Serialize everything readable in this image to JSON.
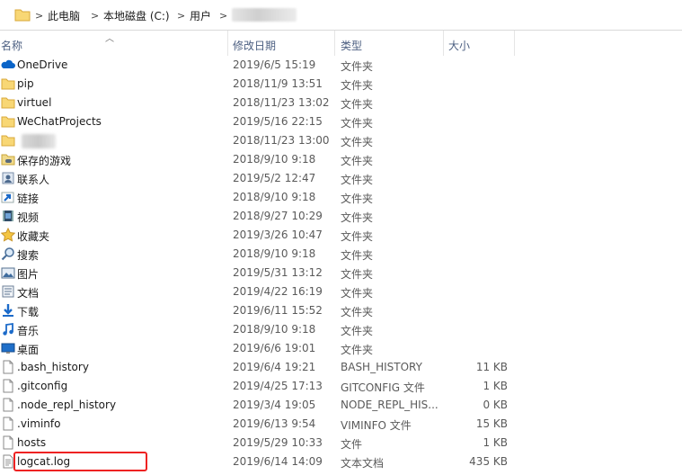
{
  "address_bar": {
    "crumbs": [
      "此电脑",
      "本地磁盘 (C:)",
      "用户"
    ],
    "separator": ">"
  },
  "columns": {
    "name": "名称",
    "date": "修改日期",
    "type": "类型",
    "size": "大小"
  },
  "icon_names": {
    "folder": "folder-icon",
    "onedrive": "onedrive-cloud-icon",
    "file": "document-file-icon"
  },
  "colors": {
    "folder_yellow": "#f8d775",
    "header_text": "#4d6082",
    "highlight_border": "#e22222",
    "onedrive_blue": "#0a64c8"
  },
  "files": [
    {
      "name": "OneDrive",
      "date": "2019/6/5 15:19",
      "type": "文件夹",
      "size": "",
      "icon": "onedrive"
    },
    {
      "name": "pip",
      "date": "2018/11/9 13:51",
      "type": "文件夹",
      "size": "",
      "icon": "folder"
    },
    {
      "name": "virtuel",
      "date": "2018/11/23 13:02",
      "type": "文件夹",
      "size": "",
      "icon": "folder"
    },
    {
      "name": "WeChatProjects",
      "date": "2019/5/16 22:15",
      "type": "文件夹",
      "size": "",
      "icon": "folder"
    },
    {
      "name": "",
      "date": "2018/11/23 13:00",
      "type": "文件夹",
      "size": "",
      "icon": "folder"
    },
    {
      "name": "保存的游戏",
      "date": "2018/9/10 9:18",
      "type": "文件夹",
      "size": "",
      "icon": "games"
    },
    {
      "name": "联系人",
      "date": "2019/5/2 12:47",
      "type": "文件夹",
      "size": "",
      "icon": "contacts"
    },
    {
      "name": "链接",
      "date": "2018/9/10 9:18",
      "type": "文件夹",
      "size": "",
      "icon": "links"
    },
    {
      "name": "视频",
      "date": "2018/9/27 10:29",
      "type": "文件夹",
      "size": "",
      "icon": "videos"
    },
    {
      "name": "收藏夹",
      "date": "2019/3/26 10:47",
      "type": "文件夹",
      "size": "",
      "icon": "favorites"
    },
    {
      "name": "搜索",
      "date": "2018/9/10 9:18",
      "type": "文件夹",
      "size": "",
      "icon": "search"
    },
    {
      "name": "图片",
      "date": "2019/5/31 13:12",
      "type": "文件夹",
      "size": "",
      "icon": "pictures"
    },
    {
      "name": "文档",
      "date": "2019/4/22 16:19",
      "type": "文件夹",
      "size": "",
      "icon": "documents"
    },
    {
      "name": "下载",
      "date": "2019/6/11 15:52",
      "type": "文件夹",
      "size": "",
      "icon": "downloads"
    },
    {
      "name": "音乐",
      "date": "2018/9/10 9:18",
      "type": "文件夹",
      "size": "",
      "icon": "music"
    },
    {
      "name": "桌面",
      "date": "2019/6/6 19:01",
      "type": "文件夹",
      "size": "",
      "icon": "desktop"
    },
    {
      "name": ".bash_history",
      "date": "2019/6/4 19:21",
      "type": "BASH_HISTORY",
      "size": "11 KB",
      "icon": "file"
    },
    {
      "name": ".gitconfig",
      "date": "2019/4/25 17:13",
      "type": "GITCONFIG 文件",
      "size": "1 KB",
      "icon": "file"
    },
    {
      "name": ".node_repl_history",
      "date": "2019/3/4 19:05",
      "type": "NODE_REPL_HIS...",
      "size": "0 KB",
      "icon": "file"
    },
    {
      "name": ".viminfo",
      "date": "2019/6/13 9:54",
      "type": "VIMINFO 文件",
      "size": "15 KB",
      "icon": "file"
    },
    {
      "name": "hosts",
      "date": "2019/5/29 10:33",
      "type": "文件",
      "size": "1 KB",
      "icon": "file"
    },
    {
      "name": "logcat.log",
      "date": "2019/6/14 14:09",
      "type": "文本文档",
      "size": "435 KB",
      "icon": "textfile"
    }
  ]
}
